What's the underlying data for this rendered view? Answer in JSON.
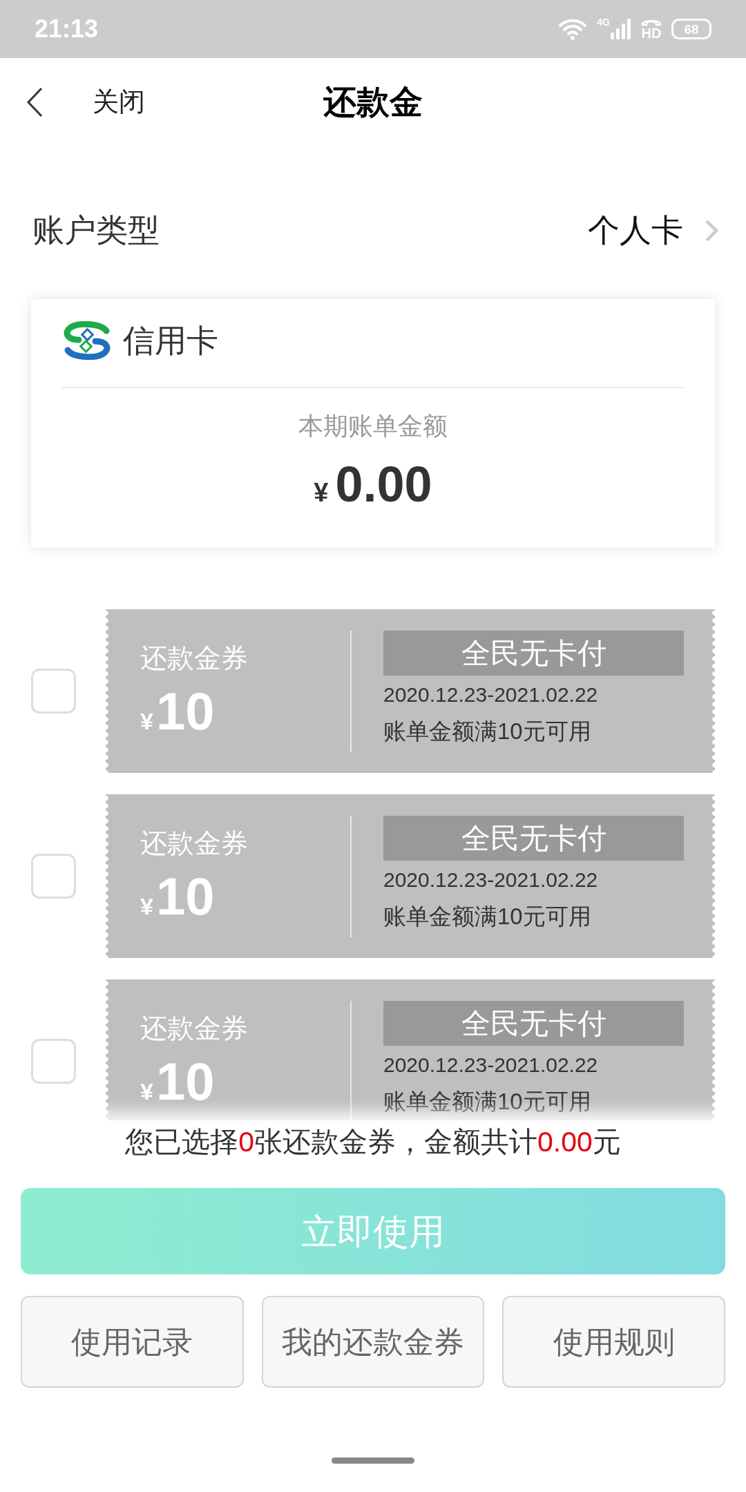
{
  "status_bar": {
    "time": "21:13",
    "network": "4G",
    "call": "HD",
    "battery": "68"
  },
  "header": {
    "close": "关闭",
    "title": "还款金"
  },
  "account_type": {
    "label": "账户类型",
    "value": "个人卡"
  },
  "bill_card": {
    "name": "信用卡",
    "amount_label": "本期账单金额",
    "currency": "¥",
    "amount": "0.00"
  },
  "coupons": [
    {
      "checked": false,
      "type": "还款金券",
      "currency": "¥",
      "value": "10",
      "tag": "全民无卡付",
      "period": "2020.12.23-2021.02.22",
      "condition": "账单金额满10元可用"
    },
    {
      "checked": false,
      "type": "还款金券",
      "currency": "¥",
      "value": "10",
      "tag": "全民无卡付",
      "period": "2020.12.23-2021.02.22",
      "condition": "账单金额满10元可用"
    },
    {
      "checked": false,
      "type": "还款金券",
      "currency": "¥",
      "value": "10",
      "tag": "全民无卡付",
      "period": "2020.12.23-2021.02.22",
      "condition": "账单金额满10元可用"
    }
  ],
  "summary": [
    {
      "text": "您已选择",
      "emphasis": false
    },
    {
      "text": "0",
      "emphasis": true
    },
    {
      "text": "张还款金券，金额共计",
      "emphasis": false
    },
    {
      "text": "0.00",
      "emphasis": true
    },
    {
      "text": "元",
      "emphasis": false
    }
  ],
  "primary_button": "立即使用",
  "buttons": [
    "使用记录",
    "我的还款金券",
    "使用规则"
  ]
}
